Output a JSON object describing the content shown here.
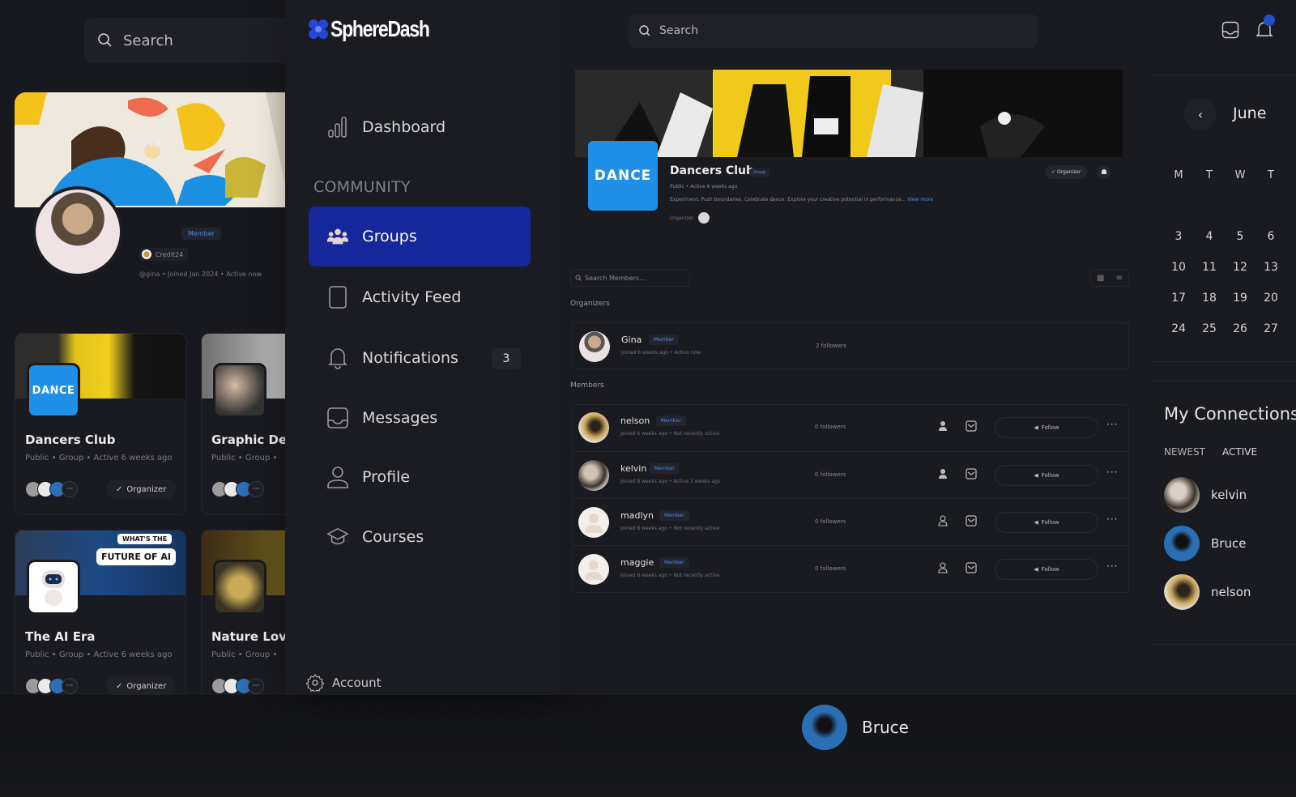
{
  "brand": {
    "name": "SphereDash",
    "accent": "#15279b",
    "link": "#4b8df0"
  },
  "background_panel": {
    "search_placeholder": "Search",
    "profile": {
      "name": "Gina",
      "role_badge": "Member",
      "chip": "Credit24",
      "meta": "@gina • Joined Jan 2024 • Active now"
    },
    "groups": [
      {
        "title": "Dancers Club",
        "meta": "Public  •  Group  •  Active 6 weeks ago",
        "logo_text": "DANCE",
        "button": "Organizer",
        "more": "···"
      },
      {
        "title": "Graphic Des",
        "meta": "Public  •  Group  •",
        "logo_text": "",
        "more": "···"
      },
      {
        "title": "The AI Era",
        "meta": "Public  •  Group  •  Active 6 weeks ago",
        "logo_text": "",
        "cover_text_1": "WHAT'S THE",
        "cover_text_2": "FUTURE OF AI",
        "button": "Organizer",
        "more": "···"
      },
      {
        "title": "Nature Love",
        "meta": "Public  •  Group  •",
        "logo_text": "",
        "more": "···"
      }
    ]
  },
  "sidebar": {
    "items": [
      {
        "label": "Dashboard",
        "icon": "bar-chart-icon"
      },
      {
        "label": "Groups",
        "icon": "users-icon",
        "active": true
      },
      {
        "label": "Activity Feed",
        "icon": "document-icon"
      },
      {
        "label": "Notifications",
        "icon": "bell-icon",
        "count": "3"
      },
      {
        "label": "Messages",
        "icon": "inbox-icon"
      },
      {
        "label": "Profile",
        "icon": "user-icon"
      },
      {
        "label": "Courses",
        "icon": "graduation-cap-icon"
      }
    ],
    "section_label": "COMMUNITY",
    "account_label": "Account"
  },
  "topbar": {
    "search_placeholder": "Search"
  },
  "group": {
    "name": "Dancers Club",
    "tag": "Group",
    "logo_text": "DANCE",
    "meta": "Public  •  Active 6 weeks ago",
    "description": "Experiment. Push boundaries. Celebrate dance. Explore your creative potential in performance...",
    "view_more": "View more",
    "organizers_label": "Organizer",
    "organizer_button": "✓ Organizer"
  },
  "members": {
    "search_placeholder": "Search Members...",
    "organizers_heading": "Organizers",
    "members_heading": "Members",
    "organizers": [
      {
        "name": "Gina",
        "role": "Member",
        "meta": "Joined 6 weeks ago  •  Active now",
        "followers": "2 followers"
      }
    ],
    "list": [
      {
        "name": "nelson",
        "role": "Member",
        "meta": "Joined 6 weeks ago  •  Not recently active",
        "followers": "0 followers",
        "follow_label": "Follow"
      },
      {
        "name": "kelvin",
        "role": "Member",
        "meta": "Joined 8 weeks ago  •  Active 3 weeks ago",
        "followers": "0 followers",
        "follow_label": "Follow"
      },
      {
        "name": "madlyn",
        "role": "Member",
        "meta": "Joined 8 weeks ago  •  Not recently active",
        "followers": "0 followers",
        "follow_label": "Follow"
      },
      {
        "name": "maggie",
        "role": "Member",
        "meta": "Joined 6 weeks ago  •  Not recently active",
        "followers": "0 followers",
        "follow_label": "Follow"
      }
    ]
  },
  "calendar": {
    "month": "June",
    "weekdays": [
      "M",
      "T",
      "W",
      "T"
    ],
    "rows": [
      [
        "3",
        "4",
        "5",
        "6"
      ],
      [
        "10",
        "11",
        "12",
        "13"
      ],
      [
        "17",
        "18",
        "19",
        "20"
      ],
      [
        "24",
        "25",
        "26",
        "27"
      ]
    ]
  },
  "connections": {
    "title": "My Connections",
    "tabs": [
      "NEWEST",
      "ACTIVE"
    ],
    "items": [
      {
        "name": "kelvin"
      },
      {
        "name": "Bruce"
      },
      {
        "name": "nelson"
      }
    ]
  },
  "bottom_peek": {
    "name": "Bruce"
  }
}
